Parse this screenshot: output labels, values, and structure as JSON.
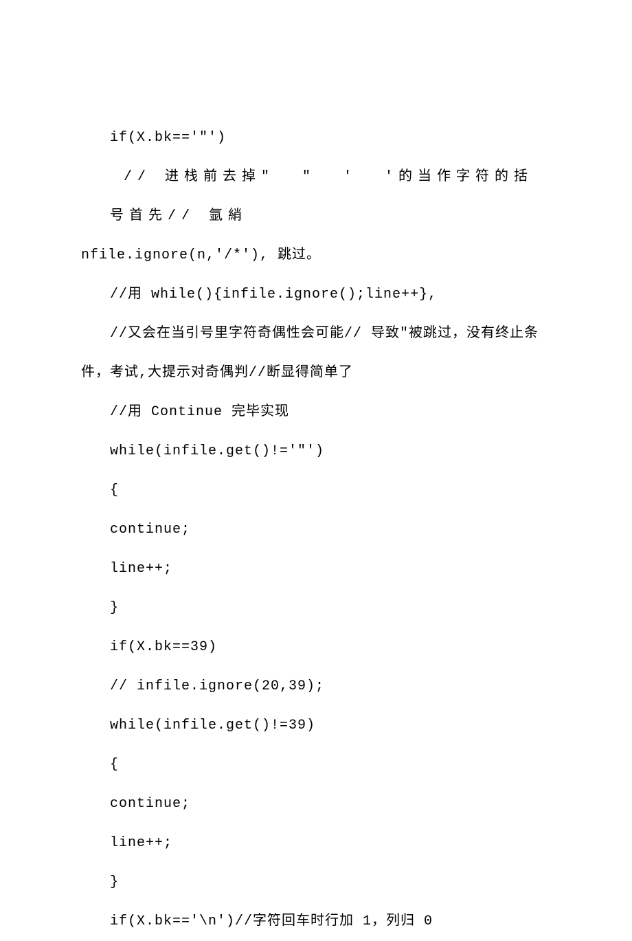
{
  "lines": [
    {
      "text": "if(X.bk=='\"')",
      "indent": true,
      "spaced": false
    },
    {
      "text": " // 进栈前去掉\"  \"  '  '的当作字符的括号首先// 氩綃",
      "indent": true,
      "spaced": true
    },
    {
      "text": "nfile.ignore(n,'/*'), 跳过。",
      "indent": false,
      "spaced": false
    },
    {
      "text": "//用 while(){infile.ignore();line++},",
      "indent": true,
      "spaced": false
    },
    {
      "text": "//又会在当引号里字符奇偶性会可能// 导致\"被跳过，没有终止条",
      "indent": true,
      "spaced": false
    },
    {
      "text": "件，考试,大提示对奇偶判//断显得简单了",
      "indent": false,
      "spaced": false
    },
    {
      "text": "//用 Continue 完毕实现",
      "indent": true,
      "spaced": false
    },
    {
      "text": "while(infile.get()!='\"')",
      "indent": true,
      "spaced": false
    },
    {
      "text": "{",
      "indent": true,
      "spaced": false
    },
    {
      "text": "continue;",
      "indent": true,
      "spaced": false
    },
    {
      "text": "line++;",
      "indent": true,
      "spaced": false
    },
    {
      "text": "}",
      "indent": true,
      "spaced": false
    },
    {
      "text": "if(X.bk==39)",
      "indent": true,
      "spaced": false
    },
    {
      "text": "// infile.ignore(20,39);",
      "indent": true,
      "spaced": false
    },
    {
      "text": "while(infile.get()!=39)",
      "indent": true,
      "spaced": false
    },
    {
      "text": "{",
      "indent": true,
      "spaced": false
    },
    {
      "text": "continue;",
      "indent": true,
      "spaced": false
    },
    {
      "text": "line++;",
      "indent": true,
      "spaced": false
    },
    {
      "text": "}",
      "indent": true,
      "spaced": false
    },
    {
      "text": "if(X.bk=='\\n')//字符回车时行加 1，列归 0",
      "indent": true,
      "spaced": false
    }
  ]
}
